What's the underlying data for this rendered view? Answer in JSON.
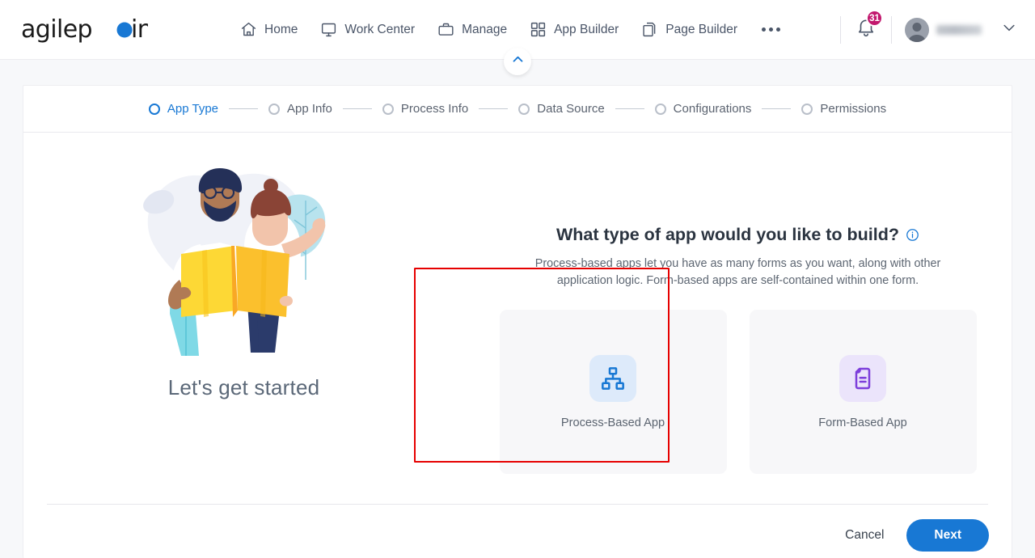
{
  "header": {
    "logo_text": "agilepoint",
    "nav": [
      {
        "label": "Home",
        "icon": "home-icon"
      },
      {
        "label": "Work Center",
        "icon": "monitor-icon"
      },
      {
        "label": "Manage",
        "icon": "briefcase-icon"
      },
      {
        "label": "App Builder",
        "icon": "grid-icon"
      },
      {
        "label": "Page Builder",
        "icon": "pages-icon"
      }
    ],
    "more_icon": "more-horizontal-icon",
    "notification_icon": "bell-icon",
    "notification_count": "31",
    "avatar_icon": "avatar",
    "user_name": "",
    "caret_icon": "chevron-down-icon",
    "collapse_icon": "chevron-up-icon"
  },
  "stepper": {
    "steps": [
      {
        "label": "App Type",
        "active": true
      },
      {
        "label": "App Info",
        "active": false
      },
      {
        "label": "Process Info",
        "active": false
      },
      {
        "label": "Data Source",
        "active": false
      },
      {
        "label": "Configurations",
        "active": false
      },
      {
        "label": "Permissions",
        "active": false
      }
    ]
  },
  "illustration": {
    "caption": "Let's get started",
    "alt": "two-people-with-map-illustration"
  },
  "main": {
    "headline": "What type of app would you like to build?",
    "info_icon": "info-icon",
    "subtext": "Process-based apps let you have as many forms as you want, along with other application logic. Form-based apps are self-contained within one form.",
    "cards": [
      {
        "label": "Process-Based App",
        "icon": "sitemap-icon",
        "accent": "#1878d4",
        "highlighted": true
      },
      {
        "label": "Form-Based App",
        "icon": "form-document-icon",
        "accent": "#7d3fdb",
        "highlighted": false
      }
    ]
  },
  "footer": {
    "cancel_label": "Cancel",
    "next_label": "Next"
  },
  "colors": {
    "primary_blue": "#1878d4",
    "badge_magenta": "#c2186e",
    "purple": "#7d3fdb",
    "annotation_red": "#e60000",
    "card_bg": "#f7f7f9",
    "page_bg": "#f7f8fa"
  }
}
